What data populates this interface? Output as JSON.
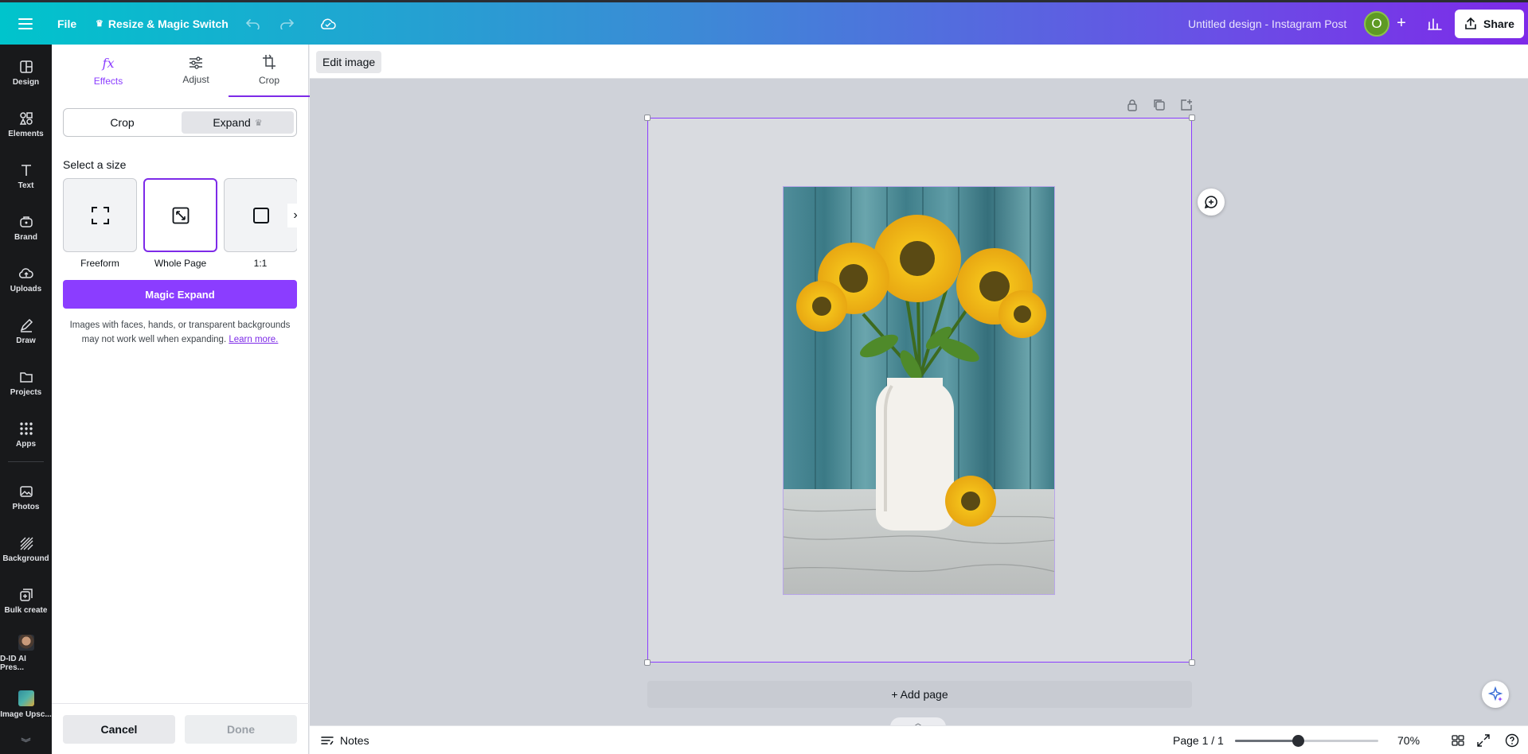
{
  "topbar": {
    "menu_icon": "hamburger-icon",
    "file_label": "File",
    "resize_label": "Resize & Magic Switch",
    "resize_icon": "crown-icon",
    "title": "Untitled design - Instagram Post",
    "avatar_initial": "O",
    "share_label": "Share"
  },
  "rail": {
    "items": [
      {
        "label": "Design",
        "icon": "layout-icon"
      },
      {
        "label": "Elements",
        "icon": "shapes-icon"
      },
      {
        "label": "Text",
        "icon": "text-icon"
      },
      {
        "label": "Brand",
        "icon": "briefcase-icon"
      },
      {
        "label": "Uploads",
        "icon": "cloud-upload-icon"
      },
      {
        "label": "Draw",
        "icon": "pen-icon"
      },
      {
        "label": "Projects",
        "icon": "folder-icon"
      },
      {
        "label": "Apps",
        "icon": "grid-icon"
      },
      {
        "label": "Photos",
        "icon": "image-icon"
      },
      {
        "label": "Background",
        "icon": "pattern-icon"
      },
      {
        "label": "Bulk create",
        "icon": "bulk-create-icon"
      },
      {
        "label": "D-ID AI Pres...",
        "icon": "d-id-app-icon"
      },
      {
        "label": "Image Upsc...",
        "icon": "image-upscaler-app-icon"
      }
    ]
  },
  "panel": {
    "tabs": [
      {
        "label": "Effects",
        "icon": "fx-icon"
      },
      {
        "label": "Adjust",
        "icon": "sliders-icon"
      },
      {
        "label": "Crop",
        "icon": "crop-icon"
      }
    ],
    "active_tab": "Crop",
    "segment": {
      "crop_label": "Crop",
      "expand_label": "Expand",
      "active": "Expand"
    },
    "section_label": "Select a size",
    "sizes": [
      {
        "label": "Freeform",
        "icon": "freeform-icon"
      },
      {
        "label": "Whole Page",
        "icon": "expand-diagonal-icon"
      },
      {
        "label": "1:1",
        "icon": "square-icon"
      }
    ],
    "selected_size": "Whole Page",
    "magic_button": "Magic Expand",
    "note_text": "Images with faces, hands, or transparent backgrounds may not work well when expanding.",
    "note_link": "Learn more.",
    "cancel_label": "Cancel",
    "done_label": "Done"
  },
  "context_toolbar": {
    "edit_image_label": "Edit image"
  },
  "canvas": {
    "add_page_label": "+ Add page",
    "photo_subject": "sunflowers-in-white-vase"
  },
  "bottombar": {
    "notes_label": "Notes",
    "page_indicator": "Page 1 / 1",
    "zoom_label": "70%",
    "zoom_value": 70
  },
  "colors": {
    "accent": "#8b3dff",
    "rail_bg": "#18191b",
    "canvas_bg": "#cfd2d9"
  }
}
